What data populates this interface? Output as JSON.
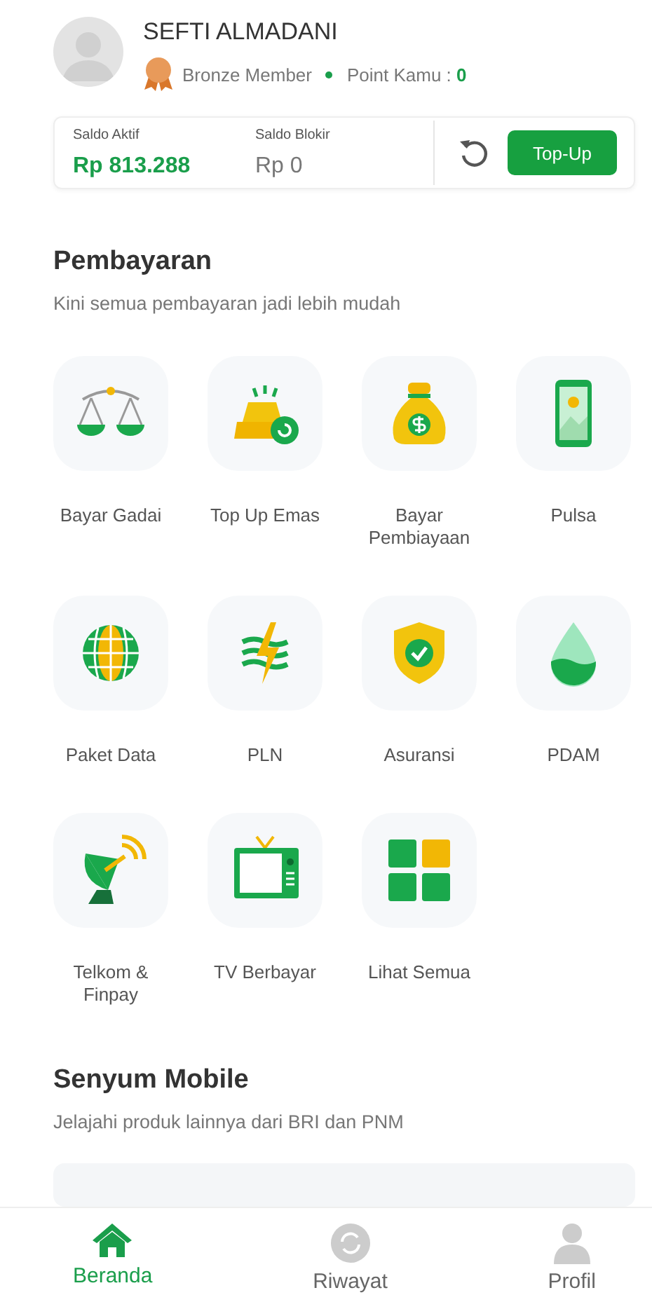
{
  "profile": {
    "name": "SEFTI ALMADANI",
    "member": "Bronze Member",
    "points_label": "Point Kamu : ",
    "points": "0"
  },
  "balance": {
    "active_label": "Saldo Aktif",
    "active_value": "Rp 813.288",
    "blocked_label": "Saldo Blokir",
    "blocked_value": "Rp 0",
    "button": "Top-Up"
  },
  "payments": {
    "title": "Pembayaran",
    "subtitle": "Kini semua pembayaran jadi lebih mudah",
    "items": [
      {
        "kind": "scale",
        "label": "Bayar Gadai"
      },
      {
        "kind": "gold",
        "label": "Top Up Emas"
      },
      {
        "kind": "moneybag",
        "label": "Bayar Pembiayaan"
      },
      {
        "kind": "phone",
        "label": "Pulsa"
      },
      {
        "kind": "globe",
        "label": "Paket Data"
      },
      {
        "kind": "bolt",
        "label": "PLN"
      },
      {
        "kind": "shield",
        "label": "Asuransi"
      },
      {
        "kind": "drop",
        "label": "PDAM"
      },
      {
        "kind": "dish",
        "label": "Telkom & Finpay"
      },
      {
        "kind": "tv",
        "label": "TV Berbayar"
      },
      {
        "kind": "grid",
        "label": "Lihat Semua"
      }
    ]
  },
  "senyum": {
    "title": "Senyum Mobile",
    "subtitle": "Jelajahi produk lainnya dari BRI dan PNM"
  },
  "nav": [
    {
      "kind": "home",
      "label": "Beranda",
      "selected": true
    },
    {
      "kind": "history",
      "label": "Riwayat",
      "selected": false
    },
    {
      "kind": "profile",
      "label": "Profil",
      "selected": false
    }
  ]
}
